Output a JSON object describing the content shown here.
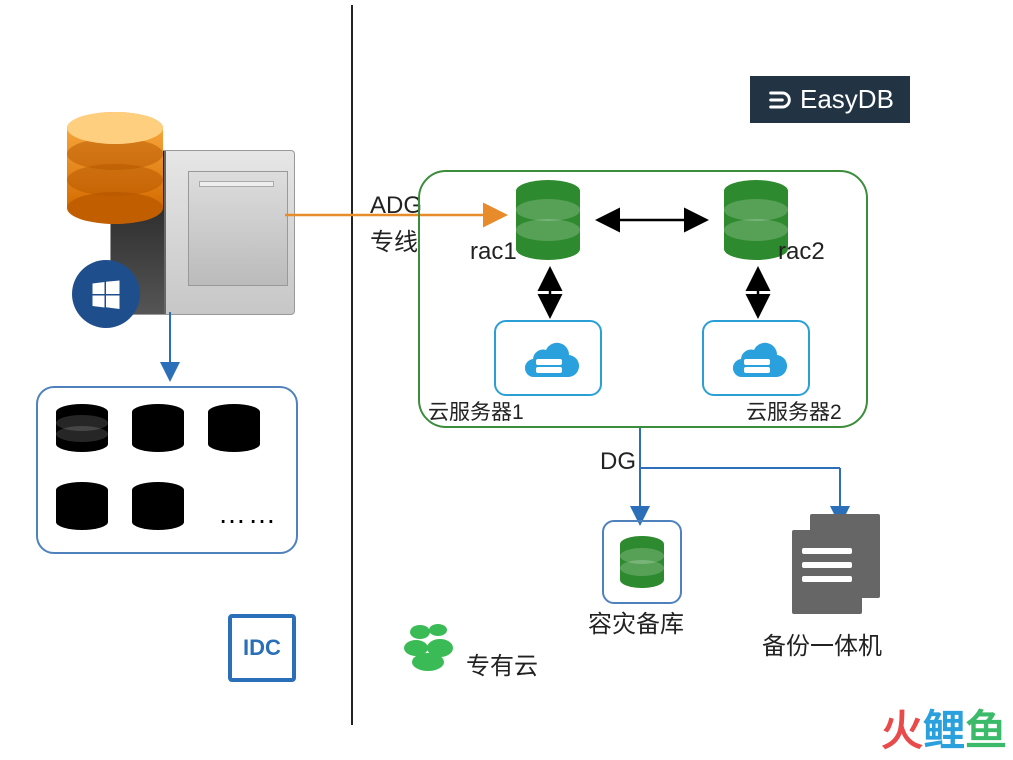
{
  "logo": {
    "text": "EasyDB"
  },
  "labels": {
    "adg": "ADG",
    "adg_line": "专线",
    "rac1": "rac1",
    "rac2": "rac2",
    "cloud1": "云服务器1",
    "cloud2": "云服务器2",
    "dg": "DG",
    "standby": "容灾备库",
    "backup": "备份一体机",
    "private_cloud": "专有云",
    "idc": "IDC",
    "ellipsis": "……"
  },
  "watermark": {
    "c1": "火",
    "c2": "鲤",
    "c3": "鱼"
  }
}
